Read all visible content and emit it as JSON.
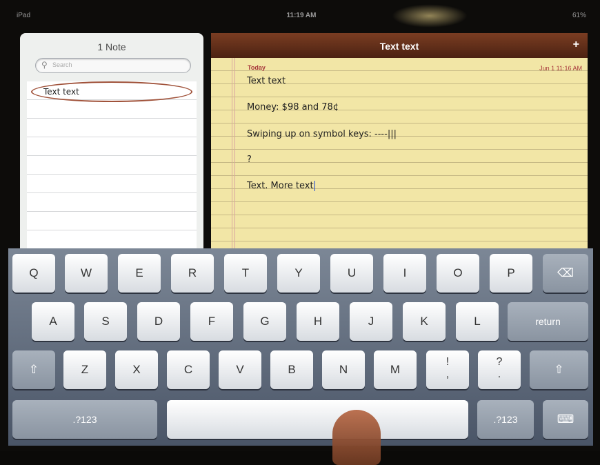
{
  "status_bar": {
    "carrier": "iPad",
    "time": "11:19 AM",
    "battery": "61%"
  },
  "notes_list": {
    "count_label": "1 Note",
    "search_placeholder": "Search",
    "items": [
      {
        "title": "Text text"
      }
    ]
  },
  "note": {
    "title": "Text text",
    "add_label": "+",
    "day_label": "Today",
    "date_label": "Jun 1  11:16 AM",
    "lines": [
      "Text text",
      "Money: $98 and 78¢",
      "Swiping up on symbol keys: ----|||",
      "?",
      "Text. More text"
    ]
  },
  "keyboard": {
    "row1": [
      "Q",
      "W",
      "E",
      "R",
      "T",
      "Y",
      "U",
      "I",
      "O",
      "P"
    ],
    "row2": [
      "A",
      "S",
      "D",
      "F",
      "G",
      "H",
      "J",
      "K",
      "L"
    ],
    "row3": [
      "Z",
      "X",
      "C",
      "V",
      "B",
      "N",
      "M"
    ],
    "return_label": "return",
    "numbers_label": ".?123",
    "punct1_top": "!",
    "punct1_bottom": ",",
    "punct2_top": "?",
    "punct2_bottom": ".",
    "icons": {
      "backspace": "backspace-icon",
      "shift": "shift-icon",
      "hide": "keyboard-hide-icon"
    }
  }
}
